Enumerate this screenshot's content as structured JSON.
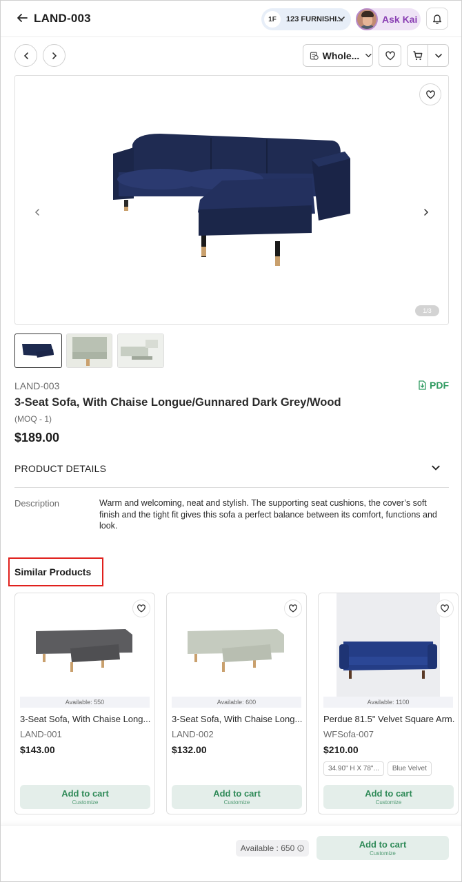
{
  "header": {
    "title": "LAND-003",
    "company_initials": "1F",
    "company_name": "123 FURNISHI...",
    "assistant_label": "Ask Kai"
  },
  "toolbar": {
    "pricing_mode": "Whole..."
  },
  "gallery": {
    "counter": "1/3"
  },
  "product": {
    "sku": "LAND-003",
    "pdf_label": "PDF",
    "title": "3-Seat Sofa, With Chaise Longue/Gunnared Dark Grey/Wood",
    "moq": "(MOQ - 1)",
    "price": "$189.00",
    "details_label": "PRODUCT DETAILS",
    "description_label": "Description",
    "description": "Warm and welcoming, neat and stylish. The supporting seat cushions, the cover’s soft finish and the tight fit gives this sofa a perfect balance between its comfort, functions and look."
  },
  "similar": {
    "title": "Similar Products",
    "add_to_cart": "Add to cart",
    "customize": "Customize",
    "items": [
      {
        "availability": "Available: 550",
        "name": "3-Seat Sofa, With Chaise Long...",
        "sku": "LAND-001",
        "price": "$143.00",
        "color": "#5c5c5f"
      },
      {
        "availability": "Available: 600",
        "name": "3-Seat Sofa, With Chaise Long...",
        "sku": "LAND-002",
        "price": "$132.00",
        "color": "#c5cbbf"
      },
      {
        "availability": "Available: 1100",
        "name": "Perdue 81.5\" Velvet Square Arm...",
        "sku": "WFSofa-007",
        "price": "$210.00",
        "tags": [
          "34.90\" H X 78\"...",
          "Blue Velvet"
        ],
        "color": "#243d86"
      }
    ]
  },
  "bottom": {
    "availability": "Available : 650",
    "add_to_cart": "Add to cart",
    "customize": "Customize"
  },
  "colors": {
    "accent_green": "#2f8a58",
    "button_bg": "#e4eeea",
    "highlight_red": "#e0201c",
    "assistant_purple": "#8a3fb3",
    "main_sofa": "#1d2a4f"
  },
  "icons": [
    "back-arrow-icon",
    "chevron-down-icon",
    "bell-icon",
    "chevron-left-icon",
    "chevron-right-icon",
    "price-tag-icon",
    "heart-icon",
    "cart-icon",
    "pdf-download-icon",
    "info-icon"
  ]
}
